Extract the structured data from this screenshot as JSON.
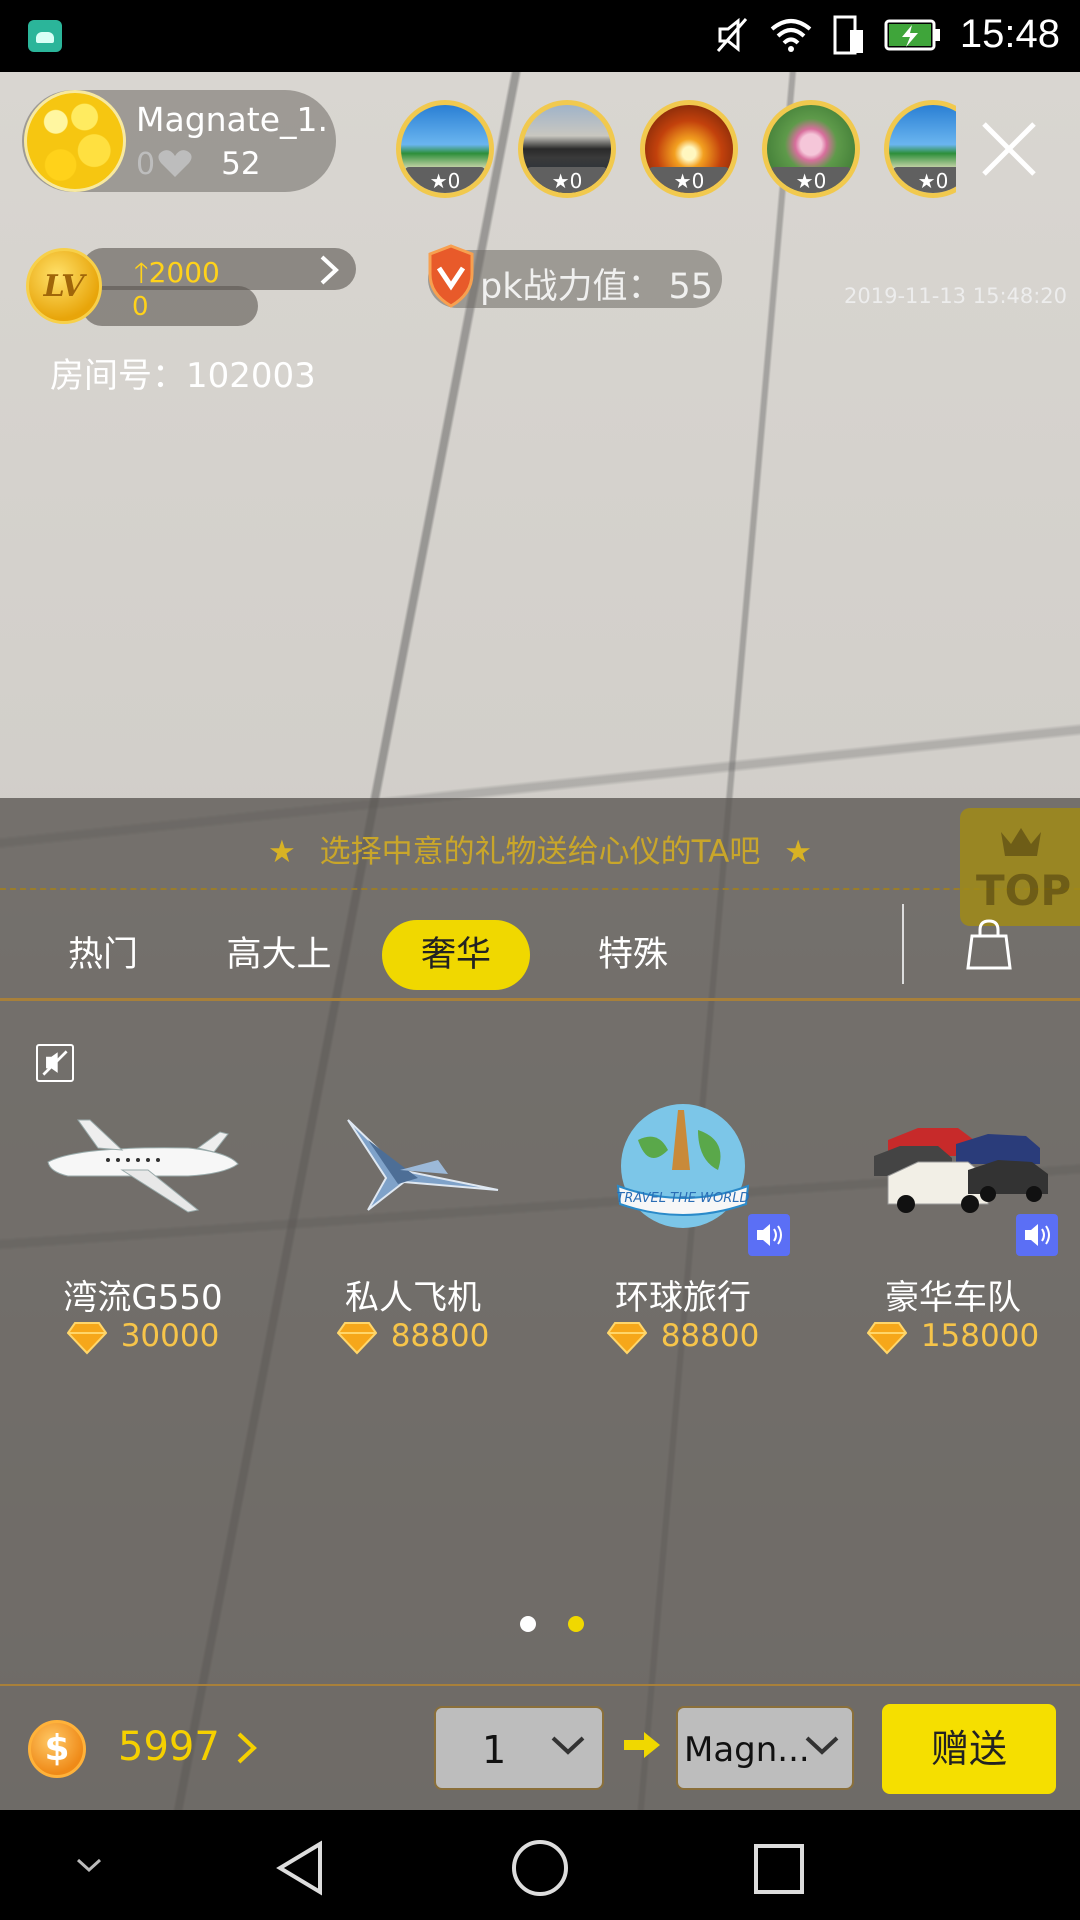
{
  "status_bar": {
    "time": "15:48",
    "icons": [
      "android-app-icon",
      "mute-icon",
      "wifi-icon",
      "sim-icon",
      "battery-charging-icon"
    ]
  },
  "host": {
    "name": "Magnate_1...",
    "zero_count": "0",
    "likes": "52"
  },
  "top_fans": [
    {
      "badge": "0",
      "icon": "beach-photo"
    },
    {
      "badge": "0",
      "icon": "city-photo"
    },
    {
      "badge": "0",
      "icon": "flower-photo"
    },
    {
      "badge": "0",
      "icon": "lotus-photo"
    },
    {
      "badge": "0",
      "icon": "beach-photo"
    }
  ],
  "level": {
    "badge": "LV",
    "up_value": "2000",
    "current": "0"
  },
  "pk": {
    "label": "pk战力值：",
    "value": "55"
  },
  "timestamp": "2019-11-13 15:48:20",
  "room": {
    "label": "房间号：",
    "number": "102003"
  },
  "panel": {
    "hint": "选择中意的礼物送给心仪的TA吧",
    "top_label": "TOP",
    "tabs": [
      {
        "label": "热门",
        "active": false
      },
      {
        "label": "高大上",
        "active": false
      },
      {
        "label": "奢华",
        "active": true
      },
      {
        "label": "特殊",
        "active": false
      }
    ],
    "gifts": [
      {
        "name": "湾流G550",
        "price": "30000",
        "sound": false
      },
      {
        "name": "私人飞机",
        "price": "88800",
        "sound": false
      },
      {
        "name": "环球旅行",
        "price": "88800",
        "sound": true,
        "image_text": "TRAVEL THE WORLD"
      },
      {
        "name": "豪华车队",
        "price": "158000",
        "sound": true
      }
    ],
    "page_count": 2,
    "current_page": 2
  },
  "footer": {
    "coin_symbol": "$",
    "balance": "5997",
    "quantity": "1",
    "target": "Magn...",
    "send_label": "赠送"
  },
  "colors": {
    "accent_yellow": "#f0d800",
    "gold_text": "#c9a62a",
    "balance_yellow": "#f5d000"
  }
}
